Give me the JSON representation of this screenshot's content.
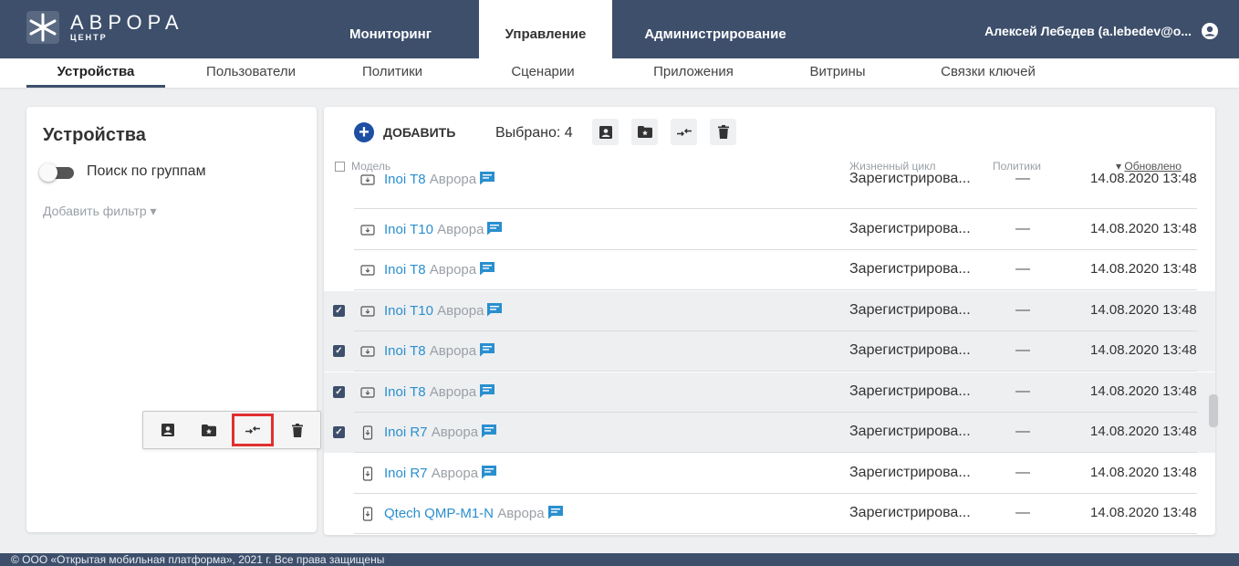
{
  "brand": {
    "name": "АВРОРА",
    "sub": "ЦЕНТР",
    "logo": "aurora-star-icon"
  },
  "main_tabs": [
    {
      "label": "Мониторинг",
      "active": false
    },
    {
      "label": "Управление",
      "active": true
    },
    {
      "label": "Администрирование",
      "active": false
    }
  ],
  "user": {
    "name": "Алексей Лебедев (a.lebedev@o...",
    "icon": "account-circle-icon"
  },
  "sub_tabs": [
    {
      "label": "Устройства",
      "active": true
    },
    {
      "label": "Пользователи"
    },
    {
      "label": "Политики"
    },
    {
      "label": "Сценарии"
    },
    {
      "label": "Приложения"
    },
    {
      "label": "Витрины"
    },
    {
      "label": "Связки ключей"
    }
  ],
  "sidebar": {
    "title": "Устройства",
    "search_groups_label": "Поиск по группам",
    "search_groups_on": false,
    "add_filter_label": "Добавить фильтр ▾"
  },
  "toolbar": {
    "add_label": "ДОБАВИТЬ",
    "selected_label": "Выбрано: 4",
    "actions": [
      "assign-user-icon",
      "move-to-group-icon",
      "swap-icon",
      "delete-icon"
    ]
  },
  "table": {
    "columns": {
      "model": "Модель",
      "lifecycle": "Жизненный цикл",
      "policies": "Политики",
      "updated": "Обновлено"
    },
    "rows": [
      {
        "model": "Inoi T8",
        "vendor": "Аврора",
        "lifecycle": "Зарегистрирова...",
        "policies": "—",
        "updated": "14.08.2020 13:48",
        "checked": false,
        "device": "tablet"
      },
      {
        "model": "Inoi T10",
        "vendor": "Аврора",
        "lifecycle": "Зарегистрирова...",
        "policies": "—",
        "updated": "14.08.2020 13:48",
        "checked": false,
        "device": "tablet"
      },
      {
        "model": "Inoi T8",
        "vendor": "Аврора",
        "lifecycle": "Зарегистрирова...",
        "policies": "—",
        "updated": "14.08.2020 13:48",
        "checked": false,
        "device": "tablet"
      },
      {
        "model": "Inoi T10",
        "vendor": "Аврора",
        "lifecycle": "Зарегистрирова...",
        "policies": "—",
        "updated": "14.08.2020 13:48",
        "checked": true,
        "device": "tablet"
      },
      {
        "model": "Inoi T8",
        "vendor": "Аврора",
        "lifecycle": "Зарегистрирова...",
        "policies": "—",
        "updated": "14.08.2020 13:48",
        "checked": true,
        "device": "tablet"
      },
      {
        "model": "Inoi T8",
        "vendor": "Аврора",
        "lifecycle": "Зарегистрирова...",
        "policies": "—",
        "updated": "14.08.2020 13:48",
        "checked": true,
        "device": "tablet"
      },
      {
        "model": "Inoi R7",
        "vendor": "Аврора",
        "lifecycle": "Зарегистрирова...",
        "policies": "—",
        "updated": "14.08.2020 13:48",
        "checked": true,
        "device": "phone"
      },
      {
        "model": "Inoi R7",
        "vendor": "Аврора",
        "lifecycle": "Зарегистрирова...",
        "policies": "—",
        "updated": "14.08.2020 13:48",
        "checked": false,
        "device": "phone"
      },
      {
        "model": "Qtech QMP-M1-N",
        "vendor": "Аврора",
        "lifecycle": "Зарегистрирова...",
        "policies": "—",
        "updated": "14.08.2020 13:48",
        "checked": false,
        "device": "phone"
      }
    ]
  },
  "floating_toolbar": {
    "actions": [
      "assign-user-icon",
      "move-to-group-icon",
      "swap-icon",
      "delete-icon"
    ],
    "highlighted": "swap-icon"
  },
  "footer": {
    "text": "© ООО «Открытая мобильная платформа», 2021 г. Все права защищены"
  },
  "colors": {
    "header": "#3d4f6b",
    "accent": "#1e4fa3",
    "link": "#2a8fcf",
    "highlight": "#e03030"
  }
}
